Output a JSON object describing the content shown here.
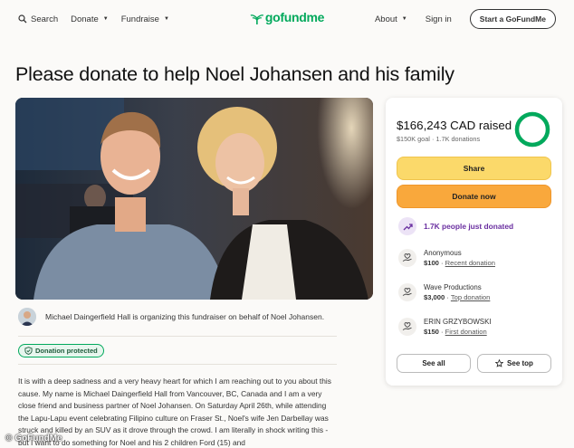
{
  "nav": {
    "search": "Search",
    "donate": "Donate",
    "fundraise": "Fundraise",
    "logo": "gofundme",
    "about": "About",
    "signin": "Sign in",
    "start": "Start a GoFundMe"
  },
  "page": {
    "title": "Please donate to help Noel Johansen and his family"
  },
  "organizer": {
    "text": "Michael Daingerfield Hall is organizing this fundraiser on behalf of Noel Johansen.",
    "badge": "Donation protected"
  },
  "story": "It is with a deep sadness and a very heavy heart for which I am reaching out to you about this cause. My name is Michael Daingerfield Hall from Vancouver, BC, Canada and I am a very close friend and business partner of Noel Johansen. On Saturday April 26th, while attending the Lapu-Lapu event celebrating Filipino culture on Fraser St., Noel's wife Jen Darbellay was struck and killed by an SUV as it drove through the crowd. I am literally in shock writing this - but I want to do something for Noel and his 2 children Ford (15) and",
  "card": {
    "raised": "$166,243 CAD raised",
    "goal": "$150K goal",
    "donations": "1.7K donations",
    "progress": 1.0,
    "share": "Share",
    "donate_now": "Donate now",
    "trend": "1.7K people just donated",
    "see_all": "See all",
    "see_top": "See top"
  },
  "donors": [
    {
      "name": "Anonymous",
      "amount": "$100",
      "tag": "Recent donation"
    },
    {
      "name": "Wave Productions",
      "amount": "$3,000",
      "tag": "Top donation"
    },
    {
      "name": "ERIN GRZYBOWSKI",
      "amount": "$150",
      "tag": "First donation"
    }
  ],
  "watermark": "GoFundMe",
  "colors": {
    "brand": "#02a95c",
    "share": "#fbd96a",
    "donate": "#f9a83c",
    "trend": "#6a2fa0"
  }
}
